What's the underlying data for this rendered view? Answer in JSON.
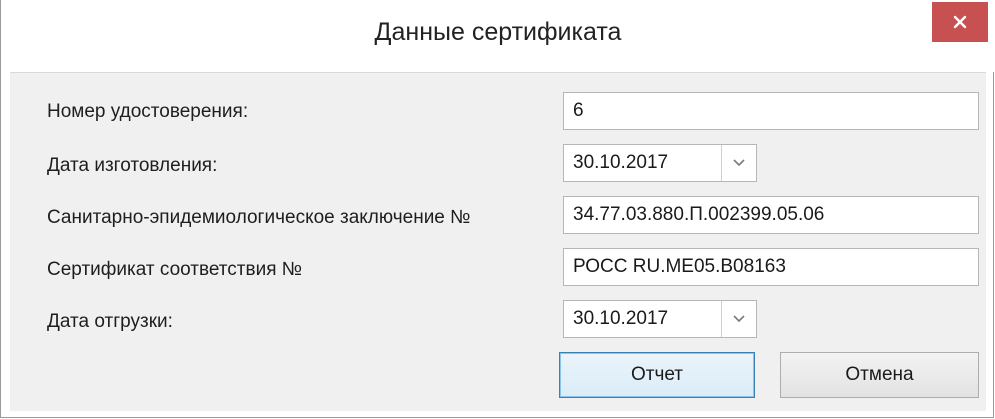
{
  "dialog": {
    "title": "Данные сертификата",
    "close_icon": "close-icon"
  },
  "form": {
    "certificate_number": {
      "label": "Номер удостоверения:",
      "value": "6"
    },
    "manufacture_date": {
      "label": "Дата изготовления:",
      "value": "30.10.2017"
    },
    "sanitary_conclusion": {
      "label": "Санитарно-эпидемиологическое заключение №",
      "value": "34.77.03.880.П.002399.05.06"
    },
    "conformity_certificate": {
      "label": "Сертификат соответствия №",
      "value": "РОСС RU.ME05.B08163"
    },
    "shipment_date": {
      "label": "Дата отгрузки:",
      "value": "30.10.2017"
    }
  },
  "buttons": {
    "report": "Отчет",
    "cancel": "Отмена"
  },
  "colors": {
    "close_button": "#c75050",
    "content_background": "#f0f0f0",
    "default_button_border": "#3c7fb1"
  }
}
